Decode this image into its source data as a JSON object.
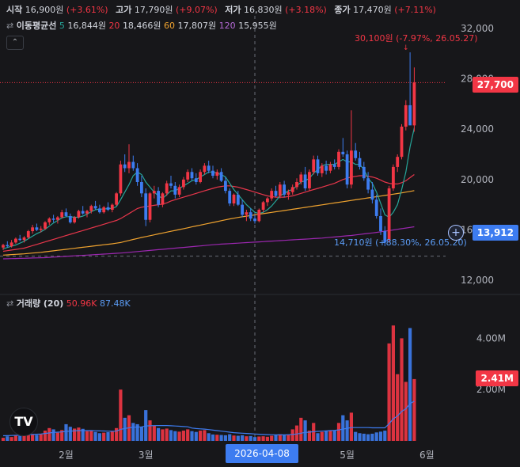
{
  "ohlc": {
    "open_label": "시작",
    "open": "16,900원",
    "open_chg": "(+3.61%)",
    "high_label": "고가",
    "high": "17,790원",
    "high_chg": "(+9.07%)",
    "low_label": "저가",
    "low": "16,830원",
    "low_chg": "(+3.18%)",
    "close_label": "종가",
    "close": "17,470원",
    "close_chg": "(+7.11%)"
  },
  "ma_legend": {
    "label": "이동평균선",
    "p5": "5",
    "v5": "16,844원",
    "p20": "20",
    "v20": "18,466원",
    "p60": "60",
    "v60": "17,807원",
    "p120": "120",
    "v120": "15,955원"
  },
  "volume_legend": {
    "label": "거래량 (20)",
    "v1": "50.96K",
    "v2": "87.48K"
  },
  "colors": {
    "up": "#f23645",
    "down": "#3d7cf0",
    "ma5": "#26a69a",
    "ma20": "#e8364b",
    "ma60": "#f0a32f",
    "ma120": "#9c27b0"
  },
  "markers": {
    "high_note": "30,100원 (-7.97%, 26.05.27)",
    "low_note": "14,710원 (+88.30%, 26.05.20)",
    "current_price": "27,700",
    "crosshair_price": "13,912",
    "current_volume": "2.41M",
    "crosshair_date": "2026-04-08"
  },
  "chart_data": {
    "type": "candlestick",
    "price_axis": {
      "ylim": [
        11000,
        33000
      ],
      "ticks": [
        "32,000",
        "28,000",
        "24,000",
        "20,000",
        "16,000",
        "12,000"
      ],
      "tick_values": [
        32000,
        28000,
        24000,
        20000,
        16000,
        12000
      ]
    },
    "volume_axis": {
      "ylim": [
        0,
        5000000
      ],
      "ticks": [
        "4.00M",
        "2.00M"
      ],
      "tick_values": [
        4000000,
        2000000
      ]
    },
    "x_ticks": [
      "2월",
      "3월",
      "5월",
      "6월"
    ],
    "x_tick_bars": [
      15,
      34,
      82,
      101
    ],
    "current_price": 27700,
    "crosshair_price": 13912,
    "crosshair_bar": 60,
    "high_marker": {
      "bar": 96,
      "price": 30100
    },
    "low_marker": {
      "bar": 91,
      "price": 14710
    },
    "candles": [
      [
        14600,
        14900,
        14400,
        14800
      ],
      [
        14800,
        15100,
        14600,
        14700
      ],
      [
        14700,
        15200,
        14600,
        15000
      ],
      [
        15000,
        15400,
        14900,
        15300
      ],
      [
        15300,
        15600,
        15100,
        15200
      ],
      [
        15200,
        15500,
        15000,
        15400
      ],
      [
        15400,
        16000,
        15300,
        15900
      ],
      [
        15900,
        16400,
        15700,
        16200
      ],
      [
        16200,
        16500,
        15900,
        16000
      ],
      [
        16000,
        16300,
        15800,
        16100
      ],
      [
        16100,
        16700,
        16000,
        16600
      ],
      [
        16600,
        17000,
        16400,
        16900
      ],
      [
        16900,
        17200,
        16600,
        16800
      ],
      [
        16800,
        17100,
        16500,
        17000
      ],
      [
        17000,
        17600,
        16900,
        17400
      ],
      [
        17400,
        17700,
        17000,
        17100
      ],
      [
        17100,
        17300,
        16500,
        16600
      ],
      [
        16600,
        17100,
        16500,
        17000
      ],
      [
        17000,
        17600,
        16900,
        17500
      ],
      [
        17500,
        17900,
        17200,
        17300
      ],
      [
        17300,
        17600,
        17000,
        17500
      ],
      [
        17500,
        18000,
        17300,
        17900
      ],
      [
        17900,
        18300,
        17600,
        17700
      ],
      [
        17700,
        18000,
        17300,
        17400
      ],
      [
        17400,
        17900,
        17300,
        17800
      ],
      [
        17800,
        18200,
        17500,
        17600
      ],
      [
        17600,
        18100,
        17400,
        18000
      ],
      [
        18000,
        19000,
        17900,
        18900
      ],
      [
        18900,
        21500,
        18700,
        21200
      ],
      [
        21200,
        22000,
        20600,
        20900
      ],
      [
        20900,
        22800,
        20500,
        21400
      ],
      [
        21400,
        21900,
        20700,
        20900
      ],
      [
        20900,
        21300,
        19500,
        19800
      ],
      [
        19800,
        20300,
        18600,
        18900
      ],
      [
        18900,
        19300,
        16300,
        16800
      ],
      [
        16800,
        19000,
        16600,
        18900
      ],
      [
        18900,
        19500,
        18500,
        19100
      ],
      [
        19100,
        19400,
        17800,
        18000
      ],
      [
        18000,
        19000,
        17800,
        18900
      ],
      [
        18900,
        19900,
        18700,
        19700
      ],
      [
        19700,
        20300,
        19300,
        19500
      ],
      [
        19500,
        19800,
        18500,
        18800
      ],
      [
        18800,
        19600,
        18600,
        19400
      ],
      [
        19400,
        20200,
        19200,
        20000
      ],
      [
        20000,
        20800,
        19800,
        20600
      ],
      [
        20600,
        20900,
        19900,
        20100
      ],
      [
        20100,
        20500,
        19600,
        19800
      ],
      [
        19800,
        20800,
        19700,
        20600
      ],
      [
        20600,
        21300,
        20400,
        21100
      ],
      [
        21100,
        21500,
        20500,
        20700
      ],
      [
        20700,
        21100,
        20100,
        20300
      ],
      [
        20300,
        20800,
        20000,
        20600
      ],
      [
        20600,
        20900,
        19800,
        19900
      ],
      [
        19900,
        20200,
        18900,
        19100
      ],
      [
        19100,
        19300,
        17900,
        18100
      ],
      [
        18100,
        18900,
        17900,
        18800
      ],
      [
        18800,
        19100,
        17900,
        18000
      ],
      [
        18000,
        18400,
        17000,
        17200
      ],
      [
        17200,
        17600,
        16700,
        17400
      ],
      [
        17400,
        17700,
        16700,
        16900
      ],
      [
        16900,
        17200,
        16500,
        16700
      ],
      [
        16700,
        17700,
        16600,
        17600
      ],
      [
        17600,
        18300,
        17400,
        18200
      ],
      [
        18200,
        18600,
        17900,
        18500
      ],
      [
        18500,
        19300,
        18300,
        19100
      ],
      [
        19100,
        19500,
        18600,
        18700
      ],
      [
        18700,
        19800,
        18500,
        19600
      ],
      [
        19600,
        19900,
        18600,
        18800
      ],
      [
        18800,
        19200,
        18400,
        19000
      ],
      [
        19000,
        19600,
        18800,
        19400
      ],
      [
        19400,
        20100,
        19200,
        19800
      ],
      [
        19800,
        20600,
        19600,
        20400
      ],
      [
        20400,
        21000,
        19100,
        19300
      ],
      [
        19300,
        20800,
        19100,
        20600
      ],
      [
        20600,
        21900,
        20400,
        21600
      ],
      [
        21600,
        21900,
        20300,
        20500
      ],
      [
        20500,
        21300,
        20200,
        21100
      ],
      [
        21100,
        21500,
        20400,
        20700
      ],
      [
        20700,
        21400,
        20500,
        21200
      ],
      [
        21200,
        21600,
        20800,
        21000
      ],
      [
        21000,
        22400,
        20800,
        22200
      ],
      [
        22200,
        23300,
        21800,
        22000
      ],
      [
        22000,
        22300,
        19300,
        19600
      ],
      [
        19600,
        25500,
        19300,
        22300
      ],
      [
        22300,
        22900,
        21500,
        21700
      ],
      [
        21700,
        22200,
        20800,
        21000
      ],
      [
        21000,
        21400,
        19900,
        20100
      ],
      [
        20100,
        20600,
        18900,
        19200
      ],
      [
        19200,
        19800,
        18100,
        18400
      ],
      [
        18400,
        18800,
        16900,
        17100
      ],
      [
        17100,
        17700,
        15600,
        15900
      ],
      [
        15900,
        16300,
        14710,
        15000
      ],
      [
        15200,
        19500,
        15000,
        19300
      ],
      [
        19300,
        21200,
        19100,
        21000
      ],
      [
        21000,
        22000,
        20600,
        21800
      ],
      [
        21800,
        24400,
        21600,
        24200
      ],
      [
        24200,
        26300,
        23900,
        25900
      ],
      [
        25900,
        30100,
        25400,
        24300
      ],
      [
        24300,
        28900,
        23800,
        27700
      ]
    ],
    "volumes": [
      120000,
      180000,
      150000,
      210000,
      190000,
      230000,
      280000,
      250000,
      230000,
      260000,
      400000,
      500000,
      450000,
      320000,
      420000,
      650000,
      550000,
      480000,
      520000,
      470000,
      380000,
      400000,
      350000,
      300000,
      320000,
      340000,
      360000,
      500000,
      2000000,
      900000,
      1000000,
      700000,
      650000,
      550000,
      1200000,
      800000,
      600000,
      500000,
      450000,
      480000,
      420000,
      380000,
      360000,
      400000,
      450000,
      380000,
      350000,
      400000,
      420000,
      300000,
      250000,
      240000,
      230000,
      220000,
      260000,
      210000,
      200000,
      220000,
      180000,
      190000,
      150000,
      170000,
      180000,
      160000,
      200000,
      220000,
      260000,
      240000,
      250000,
      450000,
      600000,
      900000,
      800000,
      400000,
      700000,
      300000,
      350000,
      380000,
      400000,
      420000,
      700000,
      1000000,
      800000,
      1100000,
      350000,
      300000,
      280000,
      260000,
      280000,
      330000,
      360000,
      400000,
      3800000,
      4500000,
      2600000,
      4000000,
      2300000,
      4400000,
      2410000
    ],
    "ma5": [
      14500,
      14600,
      14700,
      14800,
      14950,
      15100,
      15300,
      15500,
      15700,
      15850,
      16050,
      16300,
      16550,
      16750,
      16950,
      17050,
      17050,
      17000,
      17000,
      17100,
      17250,
      17450,
      17600,
      17650,
      17650,
      17700,
      17700,
      17850,
      18400,
      19000,
      19600,
      20300,
      20600,
      20400,
      19800,
      19400,
      19000,
      18700,
      18500,
      18800,
      19100,
      19100,
      19300,
      19500,
      19700,
      19900,
      20000,
      20200,
      20400,
      20600,
      20600,
      20500,
      20400,
      20200,
      19700,
      19200,
      18800,
      18400,
      18000,
      17700,
      17400,
      17300,
      17400,
      17600,
      17900,
      18300,
      18700,
      18900,
      19100,
      19200,
      19500,
      19800,
      19900,
      20100,
      20500,
      20800,
      21100,
      21200,
      21200,
      21200,
      21400,
      21600,
      21400,
      21400,
      21200,
      21200,
      20800,
      20100,
      19700,
      19000,
      18100,
      17200,
      17000,
      17400,
      18000,
      19200,
      20600,
      22600,
      24100
    ],
    "ma20": [
      14300,
      14350,
      14400,
      14450,
      14500,
      14550,
      14650,
      14750,
      14850,
      14950,
      15050,
      15150,
      15250,
      15350,
      15450,
      15550,
      15650,
      15750,
      15850,
      15950,
      16050,
      16150,
      16250,
      16350,
      16450,
      16550,
      16650,
      16750,
      16900,
      17100,
      17300,
      17500,
      17700,
      17800,
      17850,
      17900,
      17950,
      18000,
      18050,
      18150,
      18300,
      18400,
      18500,
      18600,
      18700,
      18800,
      18900,
      19000,
      19100,
      19200,
      19300,
      19400,
      19450,
      19500,
      19500,
      19450,
      19400,
      19300,
      19200,
      19100,
      19000,
      18900,
      18800,
      18700,
      18650,
      18600,
      18600,
      18600,
      18650,
      18700,
      18800,
      18900,
      19000,
      19100,
      19200,
      19300,
      19400,
      19500,
      19600,
      19700,
      19850,
      20000,
      20100,
      20200,
      20250,
      20300,
      20300,
      20250,
      20200,
      20100,
      19950,
      19800,
      19700,
      19650,
      19650,
      19750,
      19900,
      20150,
      20400
    ],
    "ma60": [
      14000,
      14020,
      14040,
      14060,
      14080,
      14100,
      14130,
      14160,
      14190,
      14220,
      14260,
      14300,
      14340,
      14380,
      14420,
      14460,
      14500,
      14540,
      14580,
      14620,
      14660,
      14700,
      14740,
      14780,
      14820,
      14860,
      14900,
      14950,
      15000,
      15080,
      15160,
      15240,
      15320,
      15400,
      15470,
      15540,
      15610,
      15680,
      15750,
      15820,
      15890,
      15960,
      16030,
      16100,
      16170,
      16240,
      16310,
      16380,
      16450,
      16520,
      16590,
      16660,
      16730,
      16800,
      16870,
      16930,
      16990,
      17040,
      17090,
      17140,
      17190,
      17240,
      17290,
      17340,
      17390,
      17440,
      17490,
      17540,
      17590,
      17640,
      17690,
      17740,
      17790,
      17840,
      17890,
      17940,
      17990,
      18040,
      18090,
      18140,
      18190,
      18240,
      18290,
      18340,
      18390,
      18440,
      18490,
      18540,
      18590,
      18640,
      18690,
      18740,
      18790,
      18840,
      18890,
      18940,
      19000,
      19060,
      19120
    ],
    "ma120": [
      13700,
      13710,
      13720,
      13730,
      13740,
      13750,
      13760,
      13770,
      13780,
      13790,
      13800,
      13820,
      13840,
      13860,
      13880,
      13900,
      13920,
      13940,
      13960,
      13980,
      14000,
      14020,
      14040,
      14060,
      14080,
      14100,
      14120,
      14140,
      14160,
      14190,
      14220,
      14250,
      14280,
      14310,
      14340,
      14370,
      14400,
      14430,
      14460,
      14490,
      14520,
      14550,
      14580,
      14610,
      14640,
      14670,
      14700,
      14730,
      14760,
      14790,
      14820,
      14850,
      14870,
      14890,
      14910,
      14930,
      14950,
      14970,
      14990,
      15010,
      15030,
      15050,
      15070,
      15090,
      15110,
      15130,
      15150,
      15170,
      15190,
      15210,
      15230,
      15250,
      15270,
      15290,
      15310,
      15330,
      15350,
      15380,
      15410,
      15440,
      15470,
      15500,
      15530,
      15560,
      15600,
      15640,
      15680,
      15720,
      15760,
      15800,
      15850,
      15900,
      15950,
      16000,
      16050,
      16100,
      16150,
      16200,
      16250
    ],
    "vol_ma20": [
      200000,
      205000,
      210000,
      215000,
      220000,
      230000,
      240000,
      250000,
      260000,
      270000,
      290000,
      310000,
      330000,
      340000,
      350000,
      370000,
      380000,
      390000,
      400000,
      400000,
      400000,
      400000,
      395000,
      390000,
      385000,
      380000,
      375000,
      380000,
      450000,
      480000,
      510000,
      530000,
      540000,
      545000,
      580000,
      590000,
      595000,
      600000,
      600000,
      600000,
      590000,
      580000,
      570000,
      560000,
      550000,
      500000,
      480000,
      470000,
      460000,
      440000,
      420000,
      400000,
      380000,
      360000,
      340000,
      320000,
      310000,
      300000,
      290000,
      280000,
      270000,
      260000,
      250000,
      245000,
      240000,
      235000,
      235000,
      235000,
      240000,
      250000,
      270000,
      300000,
      330000,
      340000,
      360000,
      370000,
      380000,
      390000,
      400000,
      410000,
      430000,
      460000,
      490000,
      520000,
      520000,
      520000,
      520000,
      520000,
      510000,
      510000,
      510000,
      510000,
      670000,
      860000,
      970000,
      1150000,
      1250000,
      1450000,
      1550000
    ]
  }
}
